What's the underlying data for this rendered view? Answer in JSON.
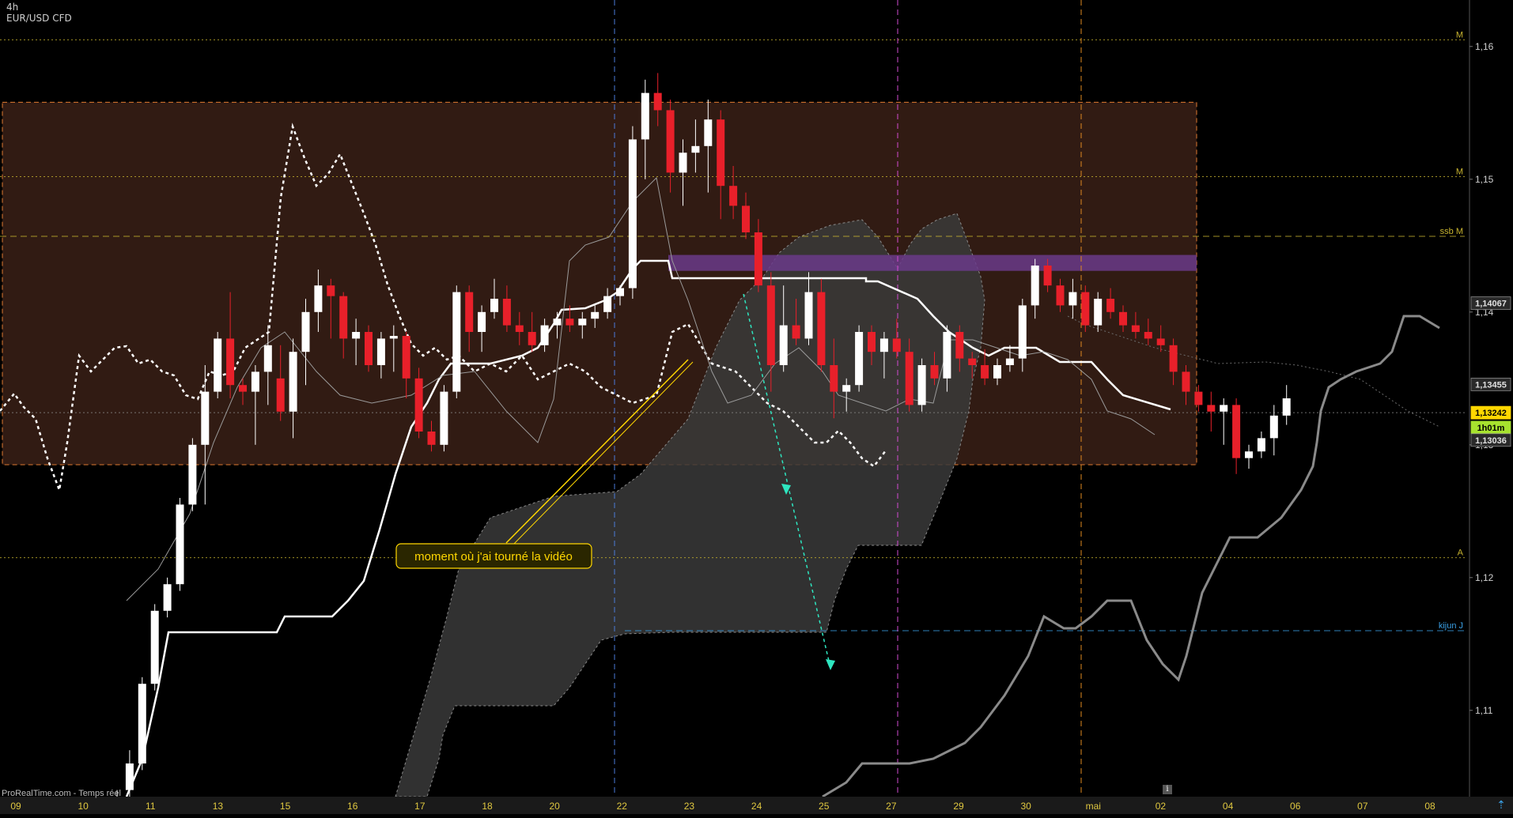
{
  "header": {
    "timeframe": "4h",
    "instrument": "EUR/USD CFD"
  },
  "watermark": "ProRealTime.com - Temps réel",
  "info_icon": "i",
  "nav_arrow_icon": "scroll-arrow-icon",
  "annotation": {
    "text": "moment où j'ai tourné la vidéo",
    "color": "#ffd700"
  },
  "colors": {
    "bull": "#ffffff",
    "bear": "#e8202a",
    "range_fill": "#3a2016",
    "range_border": "#e07a30",
    "ssb_band": "#6a3a8a",
    "kijun_j": "#3aa0e6",
    "plan": "#2ee6c0",
    "price_badge": "#ffd700",
    "timer_badge": "#a6e22e",
    "level_label": "#c8b430"
  },
  "chart_data": {
    "type": "candlestick",
    "title": "",
    "ylim": [
      1.1035,
      1.1635
    ],
    "y_ticks": [
      "1,16",
      "1,15",
      "1,14",
      "1,13",
      "1,12",
      "1,11"
    ],
    "x_ticks": [
      "09",
      "10",
      "11",
      "13",
      "15",
      "16",
      "17",
      "18",
      "20",
      "22",
      "23",
      "24",
      "25",
      "27",
      "29",
      "30",
      "mai",
      "02",
      "04",
      "06",
      "07",
      "08"
    ],
    "price_badges": [
      {
        "label": "1,14067",
        "value": 1.14067,
        "style": "gray"
      },
      {
        "label": "1,13455",
        "value": 1.13455,
        "style": "gray"
      },
      {
        "label": "1,13242",
        "value": 1.13242,
        "style": "yellow"
      },
      {
        "label": "1h01m",
        "value": 1.1313,
        "style": "green"
      },
      {
        "label": "1,13036",
        "value": 1.13036,
        "style": "gray"
      }
    ],
    "levels": [
      {
        "name": "M",
        "value": 1.1605,
        "style": "dotted",
        "label": "M",
        "color": "#c8b430"
      },
      {
        "name": "M",
        "value": 1.1502,
        "style": "dotted",
        "label": "M",
        "color": "#c8b430"
      },
      {
        "name": "ssb M",
        "value": 1.1457,
        "style": "dashed",
        "label": "ssb M",
        "color": "#c8b430"
      },
      {
        "name": "A",
        "value": 1.1215,
        "style": "dotted",
        "label": "A",
        "color": "#c8b430"
      },
      {
        "name": "kijun J",
        "value": 1.116,
        "style": "dashed",
        "label": "kijun J",
        "color": "#3aa0e6"
      },
      {
        "name": "last",
        "value": 1.13242,
        "style": "dotted",
        "label": "",
        "color": "#888888"
      }
    ],
    "range_box": {
      "x_from": 3,
      "x_to": 1513,
      "top": 1.1558,
      "bottom": 1.1285
    },
    "ssb_band": {
      "x_from": 845,
      "x_to": 1513,
      "top": 1.1443,
      "bottom": 1.1431
    },
    "vertical_markers": [
      {
        "x": 777,
        "color": "#4a7ad8"
      },
      {
        "x": 1135,
        "color": "#d24bd2"
      },
      {
        "x": 1367,
        "color": "#e08a20"
      }
    ],
    "candles": [
      [
        0,
        1.1,
        1.104,
        1.096,
        1.1035
      ],
      [
        1,
        1.104,
        1.107,
        1.102,
        1.106
      ],
      [
        2,
        1.106,
        1.1125,
        1.1055,
        1.112
      ],
      [
        3,
        1.112,
        1.118,
        1.1115,
        1.1175
      ],
      [
        4,
        1.1175,
        1.12,
        1.117,
        1.1195
      ],
      [
        5,
        1.1195,
        1.126,
        1.119,
        1.1255
      ],
      [
        6,
        1.1255,
        1.1305,
        1.125,
        1.13
      ],
      [
        7,
        1.13,
        1.136,
        1.1255,
        1.134
      ],
      [
        8,
        1.134,
        1.1385,
        1.1335,
        1.138
      ],
      [
        9,
        1.138,
        1.1415,
        1.1335,
        1.1345
      ],
      [
        10,
        1.1345,
        1.135,
        1.133,
        1.134
      ],
      [
        11,
        1.134,
        1.136,
        1.13,
        1.1355
      ],
      [
        12,
        1.1355,
        1.139,
        1.133,
        1.1375
      ],
      [
        13,
        1.135,
        1.1375,
        1.1318,
        1.1325
      ],
      [
        14,
        1.1325,
        1.138,
        1.1305,
        1.137
      ],
      [
        15,
        1.137,
        1.141,
        1.1345,
        1.14
      ],
      [
        16,
        1.14,
        1.1432,
        1.1385,
        1.142
      ],
      [
        17,
        1.142,
        1.1425,
        1.138,
        1.1412
      ],
      [
        18,
        1.1412,
        1.1415,
        1.1365,
        1.138
      ],
      [
        19,
        1.138,
        1.1395,
        1.136,
        1.1385
      ],
      [
        20,
        1.1385,
        1.139,
        1.1355,
        1.136
      ],
      [
        21,
        1.136,
        1.1385,
        1.135,
        1.138
      ],
      [
        22,
        1.138,
        1.139,
        1.1355,
        1.1382
      ],
      [
        23,
        1.1382,
        1.1385,
        1.1335,
        1.135
      ],
      [
        24,
        1.135,
        1.1358,
        1.1305,
        1.131
      ],
      [
        25,
        1.131,
        1.1318,
        1.1295,
        1.13
      ],
      [
        26,
        1.13,
        1.1345,
        1.1295,
        1.134
      ],
      [
        27,
        1.134,
        1.142,
        1.1335,
        1.1415
      ],
      [
        28,
        1.1415,
        1.142,
        1.137,
        1.1385
      ],
      [
        29,
        1.1385,
        1.1405,
        1.137,
        1.14
      ],
      [
        30,
        1.14,
        1.1425,
        1.1395,
        1.141
      ],
      [
        31,
        1.141,
        1.142,
        1.1385,
        1.139
      ],
      [
        32,
        1.139,
        1.14,
        1.1375,
        1.1385
      ],
      [
        33,
        1.1385,
        1.14,
        1.137,
        1.1375
      ],
      [
        34,
        1.1375,
        1.1395,
        1.137,
        1.139
      ],
      [
        35,
        1.139,
        1.14,
        1.138,
        1.1395
      ],
      [
        36,
        1.1395,
        1.1405,
        1.1385,
        1.139
      ],
      [
        37,
        1.139,
        1.14,
        1.138,
        1.1395
      ],
      [
        38,
        1.1395,
        1.1405,
        1.1388,
        1.14
      ],
      [
        39,
        1.14,
        1.1418,
        1.1395,
        1.1412
      ],
      [
        40,
        1.1412,
        1.142,
        1.1405,
        1.1418
      ],
      [
        41,
        1.1418,
        1.154,
        1.141,
        1.153
      ],
      [
        42,
        1.153,
        1.1575,
        1.15,
        1.1565
      ],
      [
        43,
        1.1565,
        1.158,
        1.154,
        1.1552
      ],
      [
        44,
        1.1552,
        1.156,
        1.149,
        1.1505
      ],
      [
        45,
        1.1505,
        1.153,
        1.148,
        1.152
      ],
      [
        46,
        1.152,
        1.1545,
        1.1505,
        1.1525
      ],
      [
        47,
        1.1525,
        1.156,
        1.149,
        1.1545
      ],
      [
        48,
        1.1545,
        1.1552,
        1.147,
        1.1495
      ],
      [
        49,
        1.1495,
        1.151,
        1.147,
        1.148
      ],
      [
        50,
        1.148,
        1.149,
        1.1455,
        1.146
      ],
      [
        51,
        1.146,
        1.147,
        1.1415,
        1.142
      ],
      [
        52,
        1.142,
        1.143,
        1.134,
        1.136
      ],
      [
        53,
        1.136,
        1.142,
        1.1355,
        1.139
      ],
      [
        54,
        1.139,
        1.141,
        1.1375,
        1.138
      ],
      [
        55,
        1.138,
        1.143,
        1.1375,
        1.1415
      ],
      [
        56,
        1.1415,
        1.1425,
        1.1355,
        1.136
      ],
      [
        57,
        1.136,
        1.138,
        1.132,
        1.134
      ],
      [
        58,
        1.134,
        1.135,
        1.1325,
        1.1345
      ],
      [
        59,
        1.1345,
        1.139,
        1.134,
        1.1385
      ],
      [
        60,
        1.1385,
        1.139,
        1.136,
        1.137
      ],
      [
        61,
        1.137,
        1.1385,
        1.135,
        1.138
      ],
      [
        62,
        1.138,
        1.1395,
        1.1365,
        1.137
      ],
      [
        63,
        1.137,
        1.138,
        1.1325,
        1.133
      ],
      [
        64,
        1.133,
        1.1365,
        1.1325,
        1.136
      ],
      [
        65,
        1.136,
        1.137,
        1.1345,
        1.135
      ],
      [
        66,
        1.135,
        1.139,
        1.134,
        1.1385
      ],
      [
        67,
        1.1385,
        1.139,
        1.1355,
        1.1365
      ],
      [
        68,
        1.1365,
        1.137,
        1.135,
        1.136
      ],
      [
        69,
        1.136,
        1.1372,
        1.1345,
        1.135
      ],
      [
        70,
        1.135,
        1.1365,
        1.1345,
        1.136
      ],
      [
        71,
        1.136,
        1.1375,
        1.1355,
        1.1365
      ],
      [
        72,
        1.1365,
        1.141,
        1.1355,
        1.1405
      ],
      [
        73,
        1.1405,
        1.144,
        1.1395,
        1.1435
      ],
      [
        74,
        1.1435,
        1.144,
        1.1415,
        1.142
      ],
      [
        75,
        1.142,
        1.1425,
        1.14,
        1.1405
      ],
      [
        76,
        1.1405,
        1.1425,
        1.1395,
        1.1415
      ],
      [
        77,
        1.1415,
        1.142,
        1.1385,
        1.139
      ],
      [
        78,
        1.139,
        1.1415,
        1.1385,
        1.141
      ],
      [
        79,
        1.141,
        1.1418,
        1.1395,
        1.14
      ],
      [
        80,
        1.14,
        1.1405,
        1.1385,
        1.139
      ],
      [
        81,
        1.139,
        1.14,
        1.138,
        1.1385
      ],
      [
        82,
        1.1385,
        1.1395,
        1.1375,
        1.138
      ],
      [
        83,
        1.138,
        1.139,
        1.137,
        1.1375
      ],
      [
        84,
        1.1375,
        1.138,
        1.1345,
        1.1355
      ],
      [
        85,
        1.1355,
        1.136,
        1.133,
        1.134
      ],
      [
        86,
        1.134,
        1.1345,
        1.1325,
        1.133
      ],
      [
        87,
        1.133,
        1.134,
        1.131,
        1.1325
      ],
      [
        88,
        1.1325,
        1.1335,
        1.13,
        1.133
      ],
      [
        89,
        1.133,
        1.1335,
        1.1278,
        1.129
      ],
      [
        90,
        1.129,
        1.13,
        1.1282,
        1.1295
      ],
      [
        91,
        1.1295,
        1.131,
        1.129,
        1.1305
      ],
      [
        92,
        1.1305,
        1.133,
        1.1292,
        1.1322
      ],
      [
        93,
        1.1322,
        1.1345,
        1.1315,
        1.1335
      ]
    ]
  }
}
